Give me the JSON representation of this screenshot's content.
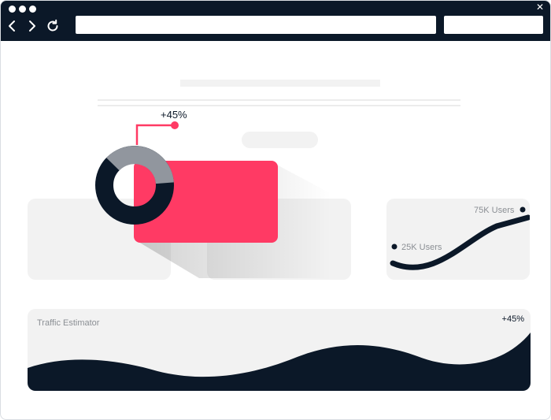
{
  "browser": {
    "controls": [
      "back-icon",
      "forward-icon",
      "reload-icon",
      "close-icon"
    ],
    "close_glyph": "✕"
  },
  "colors": {
    "navy": "#0b1828",
    "pink": "#ff3a64",
    "placeholder": "#f2f2f2",
    "donut_grey": "#9da2a8"
  },
  "donut": {
    "callout": "+45%"
  },
  "users_card": {
    "high_label": "75K Users",
    "low_label": "25K Users"
  },
  "traffic": {
    "title": "Traffic Estimator",
    "change": "+45%"
  }
}
